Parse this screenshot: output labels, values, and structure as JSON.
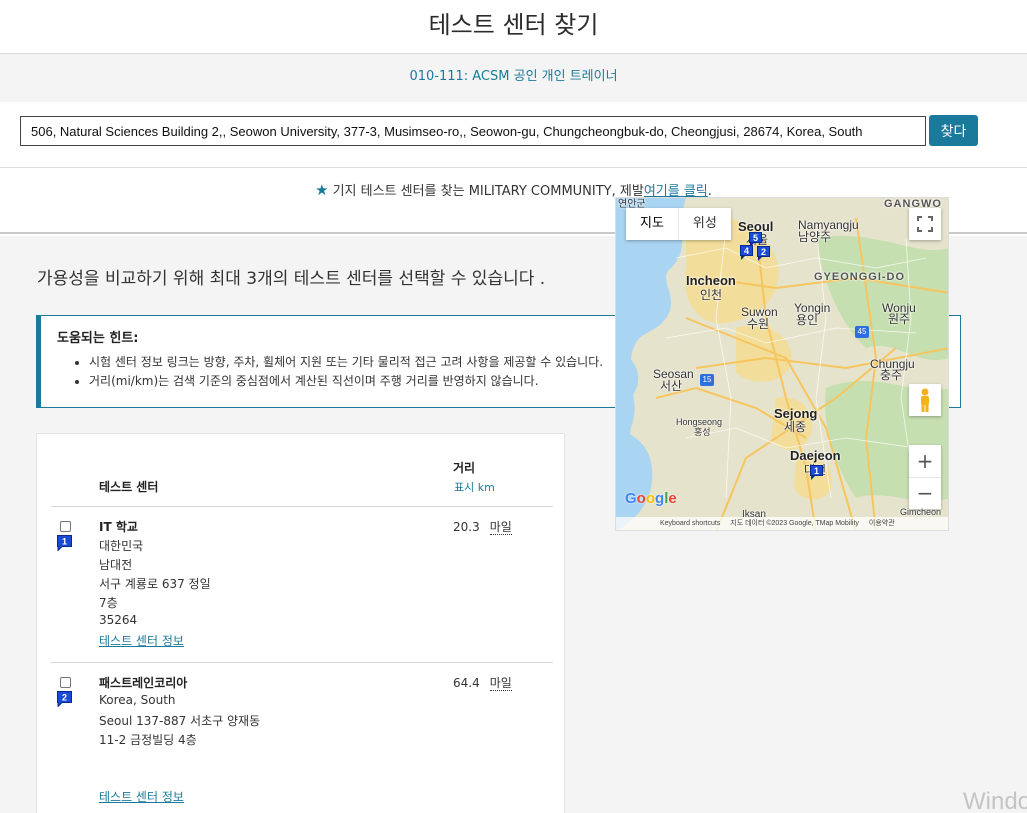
{
  "page_title": "테스트 센터 찾기",
  "exam": "010-111: ACSM 공인 개인 트레이너",
  "search": {
    "value": "506, Natural Sciences Building 2,, Seowon University, 377-3, Musimseo-ro,, Seowon-gu, Chungcheongbuk-do, Cheongjusi, 28674, Korea, South",
    "button": "찾다"
  },
  "military": {
    "text": "기지 테스트 센터를 찾는 MILITARY COMMUNITY, 제발",
    "link": "여기를 클릭",
    "suffix": ".",
    "icon": "star-icon"
  },
  "intro": "가용성을 비교하기 위해 최대 3개의 테스트 센터를 선택할 수 있습니다 .",
  "hints": {
    "title": "도움되는 힌트:",
    "items": [
      "시험 센터 정보 링크는 방향, 주차, 휠체어 지원 또는 기타 물리적 접근 고려 사항을 제공할 수 있습니다.",
      "거리(mi/km)는 검색 기준의 중심점에서 계산된 직선이며 주행 거리를 반영하지 않습니다."
    ]
  },
  "table": {
    "col_center": "테스트 센터",
    "col_distance": "거리",
    "unit_toggle": "표시 km"
  },
  "results": [
    {
      "pin": "1",
      "name": "IT 학교",
      "address": [
        "대한민국",
        "남대전",
        "서구 계룡로 637 정일",
        "7층",
        "35264"
      ],
      "link": "테스트 센터 정보",
      "distance": "20.3",
      "unit": "마일"
    },
    {
      "pin": "2",
      "name": "패스트레인코리아",
      "address": [
        "Korea, South",
        "Seoul 137-887 서초구 양재동",
        "11-2 금정빌딩 4층"
      ],
      "link": "테스트 센터 정보",
      "distance": "64.4",
      "unit": "마일"
    }
  ],
  "map": {
    "type_map": "지도",
    "type_satellite": "위성",
    "fullscreen_icon": "fullscreen-icon",
    "pegman_icon": "pegman-icon",
    "zoom_in": "+",
    "zoom_out": "−",
    "labels": {
      "top_left": "연안군",
      "gangwon": "GANGWO",
      "seoul": "Seoul",
      "seoul_kr": "서울",
      "namyangju": "Namyangju",
      "namyangju_kr": "남양주",
      "incheon": "Incheon",
      "incheon_kr": "인천",
      "gyeonggi": "GYEONGGI-DO",
      "suwon": "Suwon",
      "suwon_kr": "수원",
      "yongin": "Yongin",
      "yongin_kr": "용인",
      "wonju": "Wonju",
      "wonju_kr": "원주",
      "seosan": "Seosan",
      "seosan_kr": "서산",
      "chungju": "Chungju",
      "chungju_kr": "충주",
      "hongseong": "Hongseong",
      "hongseong_kr": "홍성",
      "sejong": "Sejong",
      "sejong_kr": "세종",
      "daejeon": "Daejeon",
      "daejeon_kr": "대전",
      "iksan": "Iksan",
      "gimcheon": "Gimcheon",
      "route_45": "45",
      "route_15": "15"
    },
    "pins": [
      "5",
      "4",
      "2",
      "1"
    ],
    "google": "Google",
    "attribution": {
      "shortcuts": "Keyboard shortcuts",
      "data": "지도 데이터 ©2023 Google, TMap Mobility",
      "terms": "이용약관"
    },
    "colors": {
      "water": "#a9d4f2",
      "land": "#e5e3cc",
      "urban": "#f2dd9a",
      "green": "#c6dfb0",
      "road": "#f6c55f"
    }
  },
  "watermark": "Windo",
  "colors": {
    "accent": "#1b7a9b",
    "pin": "#1a4bd6"
  }
}
